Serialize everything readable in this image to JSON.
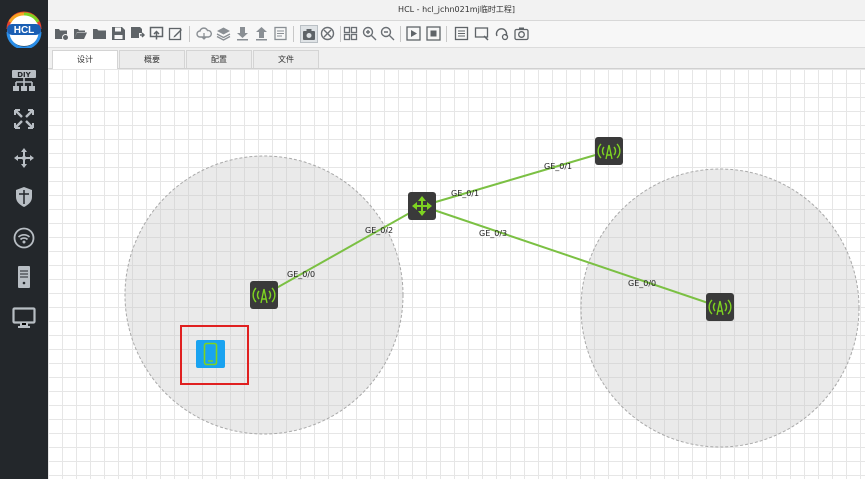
{
  "window": {
    "title": "HCL - hcl_jchn021mj临时工程]"
  },
  "logo": {
    "text": "HCL"
  },
  "sidebar": {
    "items": [
      {
        "name": "diy-device",
        "icon": "diy-icon",
        "label": "DIY"
      },
      {
        "name": "switch",
        "icon": "switch-icon"
      },
      {
        "name": "router",
        "icon": "router-icon"
      },
      {
        "name": "firewall",
        "icon": "firewall-icon"
      },
      {
        "name": "wireless",
        "icon": "wireless-icon"
      },
      {
        "name": "server",
        "icon": "server-icon"
      },
      {
        "name": "terminal",
        "icon": "terminal-icon"
      }
    ]
  },
  "toolbar": {
    "buttons": [
      "new-project-icon",
      "open-project-icon",
      "open-folder-icon",
      "save-icon",
      "save-as-icon",
      "export-icon",
      "edit-icon",
      "cloud-icon",
      "layers-icon",
      "download-icon",
      "upload-icon",
      "notes-icon",
      "capture-icon",
      "delete-link-icon",
      "grid-icon",
      "zoom-in-icon",
      "zoom-out-icon",
      "start-icon",
      "stop-icon",
      "list-icon",
      "console-icon",
      "search-device-icon",
      "screenshot-icon"
    ]
  },
  "tabs": [
    {
      "label": "设计",
      "active": true
    },
    {
      "label": "概要",
      "active": false
    },
    {
      "label": "配置",
      "active": false
    },
    {
      "label": "文件",
      "active": false
    }
  ],
  "topology": {
    "colors": {
      "link": "#7bc043",
      "device_bg": "#3a3a3a",
      "device_fg": "#7ed321",
      "selection": "#e02020",
      "phone_bg": "#1aa3f0"
    },
    "links": [
      {
        "from": "switch",
        "to": "ap-top",
        "label": "GE_0/1",
        "label_end": "ap"
      },
      {
        "from": "switch",
        "to": "ap-top",
        "label": "GE_0/1",
        "label_end": "switch"
      },
      {
        "from": "switch",
        "to": "ap-left",
        "label": "GE_0/2",
        "label_end": "switch"
      },
      {
        "from": "switch",
        "to": "ap-left",
        "label": "GE_0/0",
        "label_end": "ap"
      },
      {
        "from": "switch",
        "to": "ap-right",
        "label": "GE_0/3",
        "label_end": "switch"
      },
      {
        "from": "switch",
        "to": "ap-right",
        "label": "GE_0/0",
        "label_end": "ap"
      }
    ],
    "devices": [
      {
        "id": "switch",
        "type": "switch-icon"
      },
      {
        "id": "ap-top",
        "type": "wireless-ap-icon"
      },
      {
        "id": "ap-left",
        "type": "wireless-ap-icon"
      },
      {
        "id": "ap-right",
        "type": "wireless-ap-icon"
      },
      {
        "id": "phone",
        "type": "phone-icon",
        "selected": true
      }
    ]
  }
}
